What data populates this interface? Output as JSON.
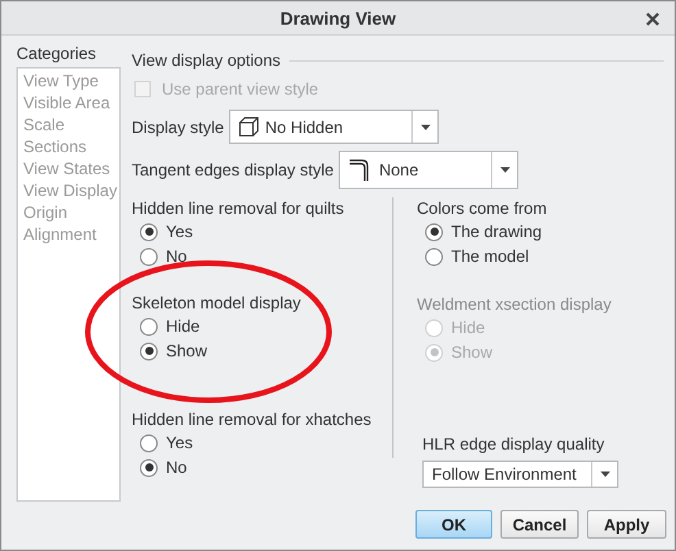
{
  "window": {
    "title": "Drawing View"
  },
  "categories": {
    "title": "Categories",
    "items": [
      {
        "label": "View Type",
        "selected": false
      },
      {
        "label": "Visible Area",
        "selected": false
      },
      {
        "label": "Scale",
        "selected": false
      },
      {
        "label": "Sections",
        "selected": false
      },
      {
        "label": "View States",
        "selected": false
      },
      {
        "label": "View Display",
        "selected": false
      },
      {
        "label": "Origin",
        "selected": false
      },
      {
        "label": "Alignment",
        "selected": false
      }
    ]
  },
  "view_display_options": {
    "title": "View display options",
    "use_parent_view_style": {
      "label": "Use parent view style",
      "checked": false,
      "disabled": true
    },
    "display_style": {
      "label": "Display style",
      "value": "No Hidden"
    },
    "tangent_edges": {
      "label": "Tangent edges display style",
      "value": "None"
    }
  },
  "left_groups": [
    {
      "title": "Hidden line removal for quilts",
      "disabled": false,
      "options": [
        {
          "label": "Yes",
          "selected": true
        },
        {
          "label": "No",
          "selected": false
        }
      ]
    },
    {
      "title": "Skeleton model display",
      "disabled": false,
      "options": [
        {
          "label": "Hide",
          "selected": false
        },
        {
          "label": "Show",
          "selected": true
        }
      ]
    },
    {
      "title": "Hidden line removal for xhatches",
      "disabled": false,
      "options": [
        {
          "label": "Yes",
          "selected": false
        },
        {
          "label": "No",
          "selected": true
        }
      ]
    }
  ],
  "right_groups": [
    {
      "title": "Colors come from",
      "disabled": false,
      "options": [
        {
          "label": "The drawing",
          "selected": true
        },
        {
          "label": "The model",
          "selected": false
        }
      ]
    },
    {
      "title": "Weldment xsection display",
      "disabled": true,
      "options": [
        {
          "label": "Hide",
          "selected": false
        },
        {
          "label": "Show",
          "selected": true
        }
      ]
    }
  ],
  "hlr_quality": {
    "label": "HLR edge display quality",
    "value": "Follow Environment"
  },
  "buttons": [
    {
      "label": "OK",
      "kind": "primary"
    },
    {
      "label": "Cancel",
      "kind": "normal"
    },
    {
      "label": "Apply",
      "kind": "normal"
    }
  ]
}
